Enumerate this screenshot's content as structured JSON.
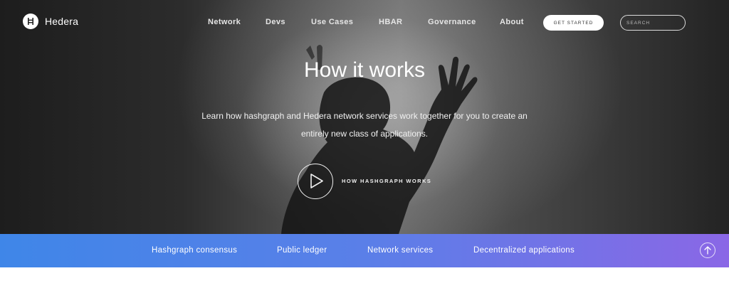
{
  "brand": {
    "name": "Hedera"
  },
  "nav": {
    "items": [
      "Network",
      "Devs",
      "Use Cases",
      "HBAR",
      "Governance",
      "About"
    ],
    "cta_label": "GET STARTED",
    "search_placeholder": "SEARCH"
  },
  "hero": {
    "title": "How it works",
    "subtitle_line1": "Learn how hashgraph and Hedera network services work together for you to create an",
    "subtitle_line2": "entirely new class of applications.",
    "video_label": "HOW HASHGRAPH WORKS"
  },
  "subnav": {
    "items": [
      "Hashgraph consensus",
      "Public ledger",
      "Network services",
      "Decentralized applications"
    ]
  },
  "icons": {
    "logo": "hedera-logo-icon",
    "play": "play-icon",
    "scroll_top": "arrow-up-icon"
  },
  "colors": {
    "subnav_start": "#3f86e8",
    "subnav_end": "#8a67e6"
  }
}
